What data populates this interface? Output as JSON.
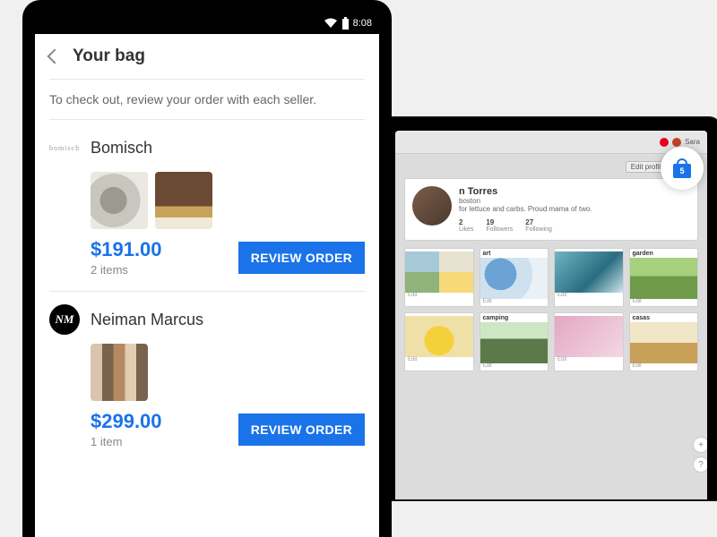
{
  "statusbar": {
    "time": "8:08"
  },
  "header": {
    "title": "Your bag"
  },
  "instruction": "To check out, review your order with each seller.",
  "sellers": [
    {
      "name": "Bomisch",
      "logo_text": "bomisch",
      "price": "$191.00",
      "items_label": "2 items",
      "review_label": "REVIEW ORDER"
    },
    {
      "name": "Neiman Marcus",
      "price": "$299.00",
      "items_label": "1 item",
      "review_label": "REVIEW ORDER"
    }
  ],
  "laptop": {
    "user_name": "Sara",
    "edit_profile": "Edit profile",
    "profile_name_suffix": "n Torres",
    "profile_loc": "boston",
    "profile_bio_suffix": "for lettuce and carbs. Proud mama of two.",
    "stats": [
      {
        "value": "2",
        "label": "Likes"
      },
      {
        "value": "19",
        "label": "Followers"
      },
      {
        "value": "27",
        "label": "Following"
      }
    ],
    "boards_row1": [
      "",
      "art",
      "",
      "garden"
    ],
    "boards_row2": [
      "",
      "camping",
      "",
      "casas"
    ],
    "edit_label": "Edit",
    "bag_count": "5"
  }
}
